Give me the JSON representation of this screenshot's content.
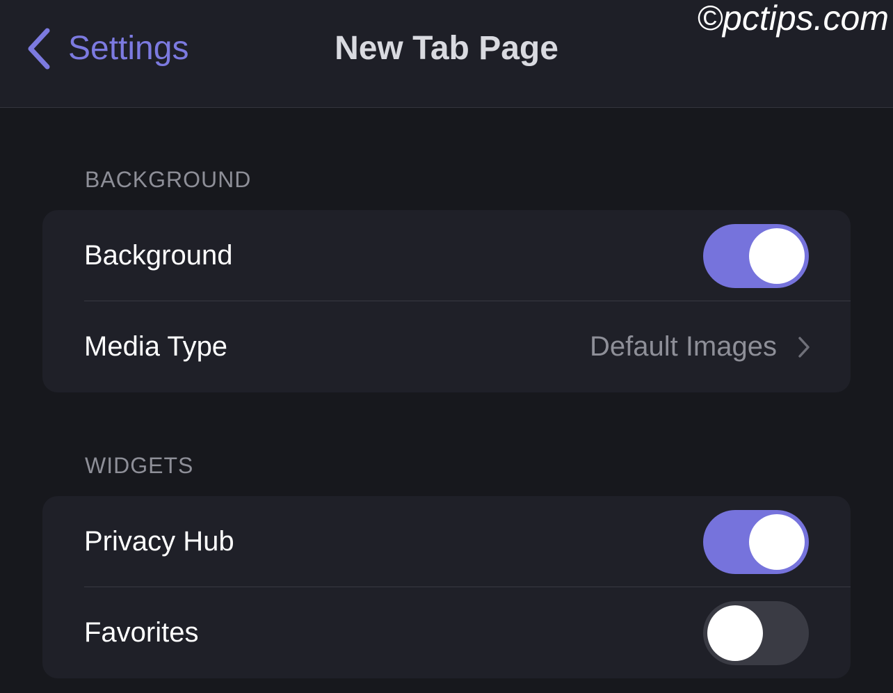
{
  "navbar": {
    "back_label": "Settings",
    "title": "New Tab Page"
  },
  "watermark": "©pctips.com",
  "sections": [
    {
      "header": "BACKGROUND",
      "rows": [
        {
          "label": "Background",
          "type": "toggle",
          "on": true
        },
        {
          "label": "Media Type",
          "type": "disclosure",
          "value": "Default Images"
        }
      ]
    },
    {
      "header": "WIDGETS",
      "rows": [
        {
          "label": "Privacy Hub",
          "type": "toggle",
          "on": true
        },
        {
          "label": "Favorites",
          "type": "toggle",
          "on": false
        }
      ]
    }
  ],
  "colors": {
    "accent": "#7673dc",
    "background": "#17181d",
    "navbar": "#1e1f27",
    "group": "#1f2028",
    "toggle_off": "#3a3b44",
    "secondary_text": "#8e8f98"
  },
  "icons": {
    "back": "chevron-left-icon",
    "disclosure": "chevron-right-icon"
  }
}
